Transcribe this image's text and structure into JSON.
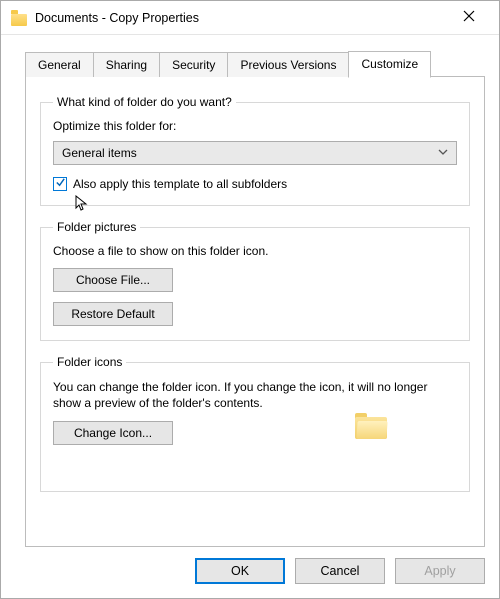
{
  "window": {
    "title": "Documents - Copy Properties"
  },
  "tabs": {
    "general": "General",
    "sharing": "Sharing",
    "security": "Security",
    "previous": "Previous Versions",
    "customize": "Customize",
    "active": "customize"
  },
  "group_kind": {
    "legend": "What kind of folder do you want?",
    "optimize_label": "Optimize this folder for:",
    "select_value": "General items",
    "checkbox_label": "Also apply this template to all subfolders",
    "checkbox_checked": true
  },
  "group_pictures": {
    "legend": "Folder pictures",
    "instruction": "Choose a file to show on this folder icon.",
    "choose_file": "Choose File...",
    "restore_default": "Restore Default"
  },
  "group_icons": {
    "legend": "Folder icons",
    "instruction": "You can change the folder icon. If you change the icon, it will no longer show a preview of the folder's contents.",
    "change_icon": "Change Icon..."
  },
  "buttons": {
    "ok": "OK",
    "cancel": "Cancel",
    "apply": "Apply"
  }
}
